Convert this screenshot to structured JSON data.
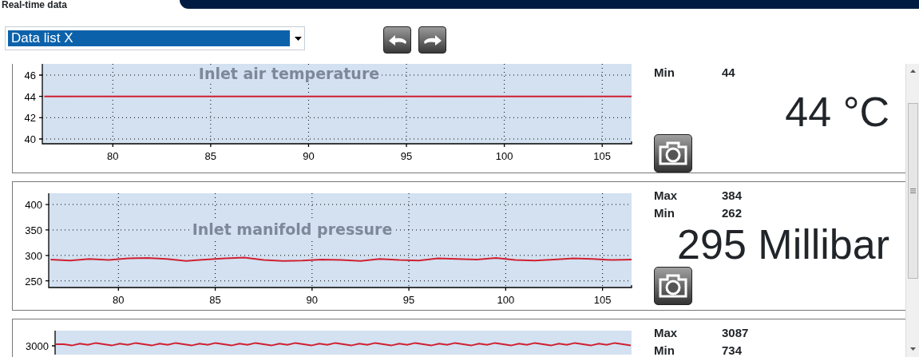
{
  "header": {
    "title": "Real-time data"
  },
  "toolbar": {
    "dropdown": {
      "value": "Data list X"
    }
  },
  "panels": [
    {
      "stats": [
        {
          "label": "Min",
          "value": "44"
        }
      ],
      "reading": "44 °C",
      "chart_data": {
        "type": "line",
        "title": "Inlet air temperature",
        "x": [
          76.5,
          77.5,
          78.5,
          79.5,
          80.5,
          81.5,
          82.5,
          83.5,
          84.5,
          85.5,
          86.5,
          87.5,
          88.5,
          89.5,
          90.5,
          91.5,
          92.5,
          93.5,
          94.5,
          95.5,
          96.5,
          97.5,
          98.5,
          99.5,
          100.5,
          101.5,
          102.5,
          103.5,
          104.5,
          105.5,
          106.5
        ],
        "series": [
          {
            "color": "#d02030",
            "values": [
              44,
              44,
              44,
              44,
              44,
              44,
              44,
              44,
              44,
              44,
              44,
              44,
              44,
              44,
              44,
              44,
              44,
              44,
              44,
              44,
              44,
              44,
              44,
              44,
              44,
              44,
              44,
              44,
              44,
              44,
              44
            ]
          }
        ],
        "xlim": [
          76.4,
          106.5
        ],
        "ylim": [
          39.55,
          47.05
        ],
        "grid": true,
        "xticks": [
          80,
          85,
          90,
          95,
          100,
          105
        ],
        "yticks": [
          40,
          42,
          44,
          46
        ]
      }
    },
    {
      "stats": [
        {
          "label": "Max",
          "value": "384"
        },
        {
          "label": "Min",
          "value": "262"
        }
      ],
      "reading": "295 Millibar",
      "chart_data": {
        "type": "line",
        "title": "Inlet manifold pressure",
        "x": [
          76.5,
          77.5,
          78.5,
          79.5,
          80.5,
          81.5,
          82.5,
          83.5,
          84.5,
          85.5,
          86.5,
          87.5,
          88.5,
          89.5,
          90.5,
          91.5,
          92.5,
          93.5,
          94.5,
          95.5,
          96.5,
          97.5,
          98.5,
          99.5,
          100.5,
          101.5,
          102.5,
          103.5,
          104.5,
          105.5,
          106.5
        ],
        "series": [
          {
            "color": "#d02030",
            "values": [
              292,
              290,
              293,
              291,
              294,
              295,
              293,
              289,
              292,
              294,
              296,
              291,
              289,
              290,
              292,
              291,
              289,
              293,
              291,
              290,
              294,
              293,
              292,
              295,
              291,
              290,
              292,
              294,
              293,
              291,
              292
            ]
          }
        ],
        "xlim": [
          76.4,
          106.5
        ],
        "ylim": [
          237,
          422
        ],
        "grid": true,
        "xticks": [
          80,
          85,
          90,
          95,
          100,
          105
        ],
        "yticks": [
          250,
          300,
          350,
          400
        ]
      }
    },
    {
      "stats": [
        {
          "label": "Max",
          "value": "3087"
        },
        {
          "label": "Min",
          "value": "734"
        }
      ],
      "chart_picture": {
        "y_tick_label": "3000"
      }
    }
  ]
}
